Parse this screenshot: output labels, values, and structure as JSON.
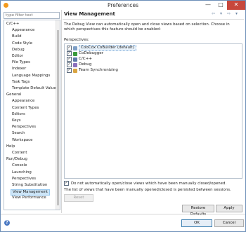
{
  "window": {
    "title": "Preferences",
    "min": "—",
    "max": "□",
    "close": "✕"
  },
  "filter": {
    "placeholder": "type filter text"
  },
  "tree": [
    {
      "label": "C/C++",
      "indent": 0
    },
    {
      "label": "Appearance",
      "indent": 1
    },
    {
      "label": "Build",
      "indent": 1
    },
    {
      "label": "Code Style",
      "indent": 1
    },
    {
      "label": "Debug",
      "indent": 1
    },
    {
      "label": "Editor",
      "indent": 1
    },
    {
      "label": "File Types",
      "indent": 1
    },
    {
      "label": "Indexer",
      "indent": 1
    },
    {
      "label": "Language Mappings",
      "indent": 1
    },
    {
      "label": "Task Tags",
      "indent": 1
    },
    {
      "label": "Template Default Value",
      "indent": 1
    },
    {
      "label": "General",
      "indent": 0
    },
    {
      "label": "Appearance",
      "indent": 1
    },
    {
      "label": "Content Types",
      "indent": 1
    },
    {
      "label": "Editors",
      "indent": 1
    },
    {
      "label": "Keys",
      "indent": 1
    },
    {
      "label": "Perspectives",
      "indent": 1
    },
    {
      "label": "Search",
      "indent": 1
    },
    {
      "label": "Workspace",
      "indent": 1
    },
    {
      "label": "Help",
      "indent": 0
    },
    {
      "label": "Content",
      "indent": 1
    },
    {
      "label": "Run/Debug",
      "indent": 0
    },
    {
      "label": "Console",
      "indent": 1
    },
    {
      "label": "Launching",
      "indent": 1
    },
    {
      "label": "Perspectives",
      "indent": 1
    },
    {
      "label": "String Substitution",
      "indent": 1
    },
    {
      "label": "View Management",
      "indent": 1,
      "selected": true
    },
    {
      "label": "View Performance",
      "indent": 1
    }
  ],
  "page": {
    "title": "View Management",
    "description": "The Debug View can automatically open and close views based on selection. Choose in which perspectives this feature should be enabled:",
    "perspectives_label": "Perspectives:",
    "perspectives": [
      {
        "label": "CooCox CoBuilder (default)",
        "checked": true,
        "color": "#7d9fc7",
        "selected": true
      },
      {
        "label": "CoDebugger",
        "checked": true,
        "color": "#3a9a3a"
      },
      {
        "label": "C/C++",
        "checked": true,
        "color": "#5d79a8"
      },
      {
        "label": "Debug",
        "checked": true,
        "color": "#8a6fbd"
      },
      {
        "label": "Team Synchronizing",
        "checked": true,
        "color": "#d9a441"
      }
    ],
    "option_label": "Do not automatically open/close views which have been manually closed/opened.",
    "option_checked": true,
    "note": "The list of views that have been manually opened/closed is persisted between sessions.",
    "reset_label": "Reset",
    "restore_defaults_label": "Restore Defaults",
    "apply_label": "Apply"
  },
  "dialog": {
    "ok_label": "OK",
    "cancel_label": "Cancel",
    "help_glyph": "?"
  },
  "nav": {
    "back": "⇦",
    "back_menu": "▾",
    "forward": "⇨",
    "forward_menu": "▾"
  }
}
